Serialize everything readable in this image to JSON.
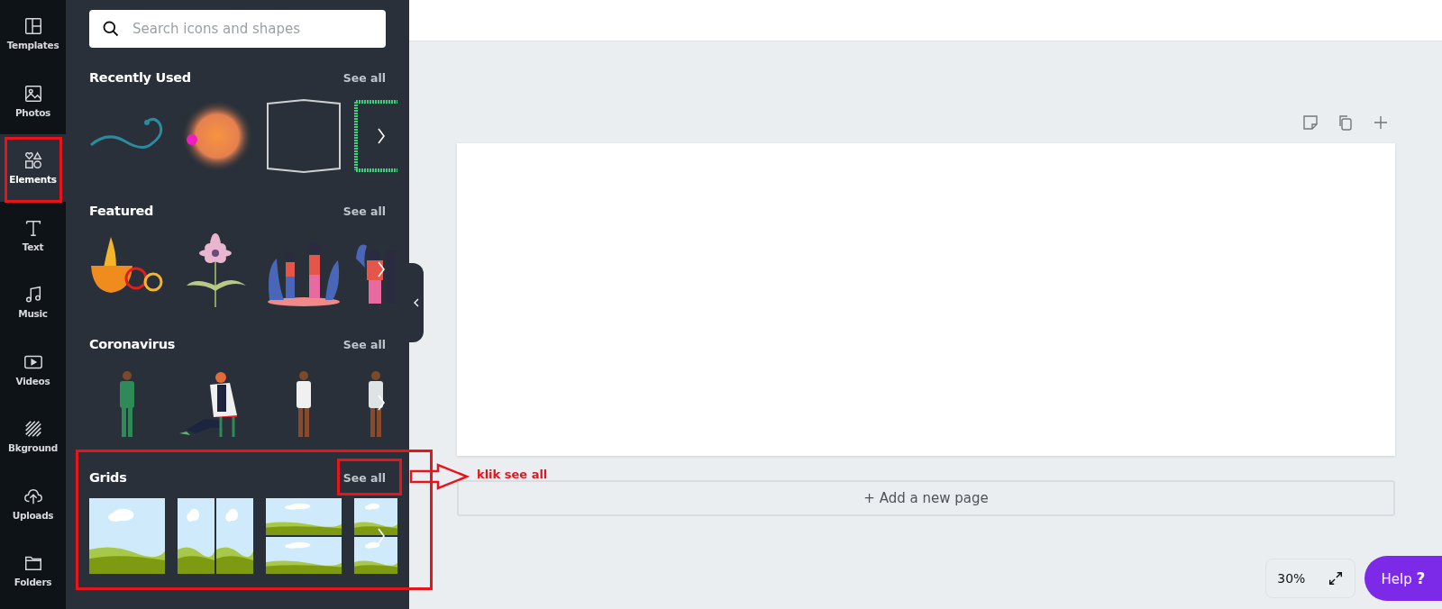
{
  "sidebar": {
    "items": [
      {
        "label": "Templates",
        "selected": false
      },
      {
        "label": "Photos",
        "selected": false
      },
      {
        "label": "Elements",
        "selected": true
      },
      {
        "label": "Text",
        "selected": false
      },
      {
        "label": "Music",
        "selected": false
      },
      {
        "label": "Videos",
        "selected": false
      },
      {
        "label": "Bkground",
        "selected": false
      },
      {
        "label": "Uploads",
        "selected": false
      },
      {
        "label": "Folders",
        "selected": false
      }
    ]
  },
  "search": {
    "placeholder": "Search icons and shapes"
  },
  "sections": [
    {
      "title": "Recently Used",
      "see_all": "See all",
      "thumbnails": [
        {
          "kind": "swirl"
        },
        {
          "kind": "blob"
        },
        {
          "kind": "frame"
        },
        {
          "kind": "green-frame"
        }
      ]
    },
    {
      "title": "Featured",
      "see_all": "See all",
      "thumbnails": [
        {
          "kind": "bowl"
        },
        {
          "kind": "flower"
        },
        {
          "kind": "people"
        },
        {
          "kind": "person"
        }
      ]
    },
    {
      "title": "Coronavirus",
      "see_all": "See all",
      "thumbnails": [
        {
          "kind": "doctor"
        },
        {
          "kind": "seated-doctor"
        },
        {
          "kind": "doctor"
        },
        {
          "kind": "doctor"
        }
      ]
    },
    {
      "title": "Grids",
      "see_all": "See all",
      "thumbnails": [
        {
          "kind": "single"
        },
        {
          "kind": "two-columns"
        },
        {
          "kind": "two-rows"
        },
        {
          "kind": "two-rows"
        }
      ]
    }
  ],
  "canvas": {
    "add_page": "+ Add a new page",
    "zoom": "30%",
    "help": {
      "label": "Help",
      "glyph": "?"
    }
  },
  "annotation": {
    "text": "klik see all"
  }
}
